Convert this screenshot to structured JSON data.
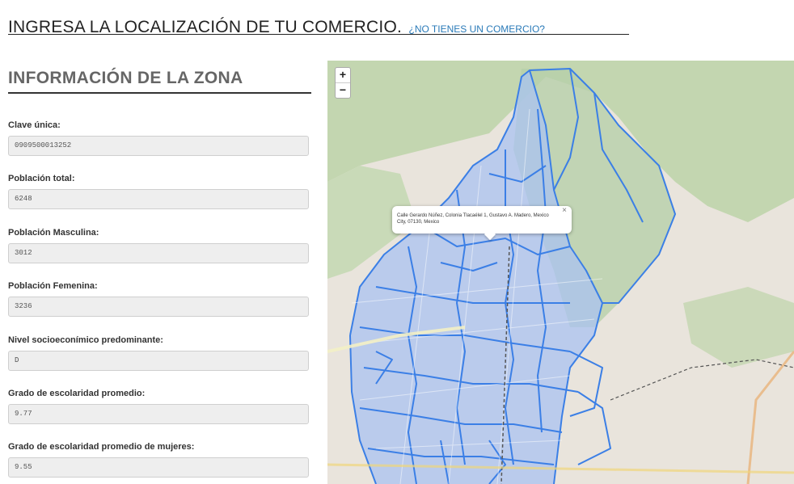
{
  "header": {
    "title": "INGRESA LA LOCALIZACIÓN DE TU COMERCIO.",
    "link": "¿NO TIENES UN COMERCIO?"
  },
  "zone": {
    "title": "INFORMACIÓN DE LA ZONA",
    "fields": [
      {
        "label": "Clave única:",
        "value": "0909500013252"
      },
      {
        "label": "Población total:",
        "value": "6248"
      },
      {
        "label": "Población Masculina:",
        "value": "3012"
      },
      {
        "label": "Población Femenina:",
        "value": "3236"
      },
      {
        "label": "Nivel socioeconímico predominante:",
        "value": "D"
      },
      {
        "label": "Grado de escolaridad promedio:",
        "value": "9.77"
      },
      {
        "label": "Grado de escolaridad promedio de mujeres:",
        "value": "9.55"
      }
    ]
  },
  "map": {
    "zoom_in": "+",
    "zoom_out": "−",
    "popup_text": "Calle Gerardo Núñez, Colonia Tlacaélel 1, Gustavo A. Madero, Mexico City, 07130, Mexico",
    "popup_close": "×",
    "colors": {
      "boundary": "#3b7fe6",
      "fill": "#a9c3f2",
      "green": "#bcd2a8",
      "urban": "#e9e4dc"
    }
  }
}
